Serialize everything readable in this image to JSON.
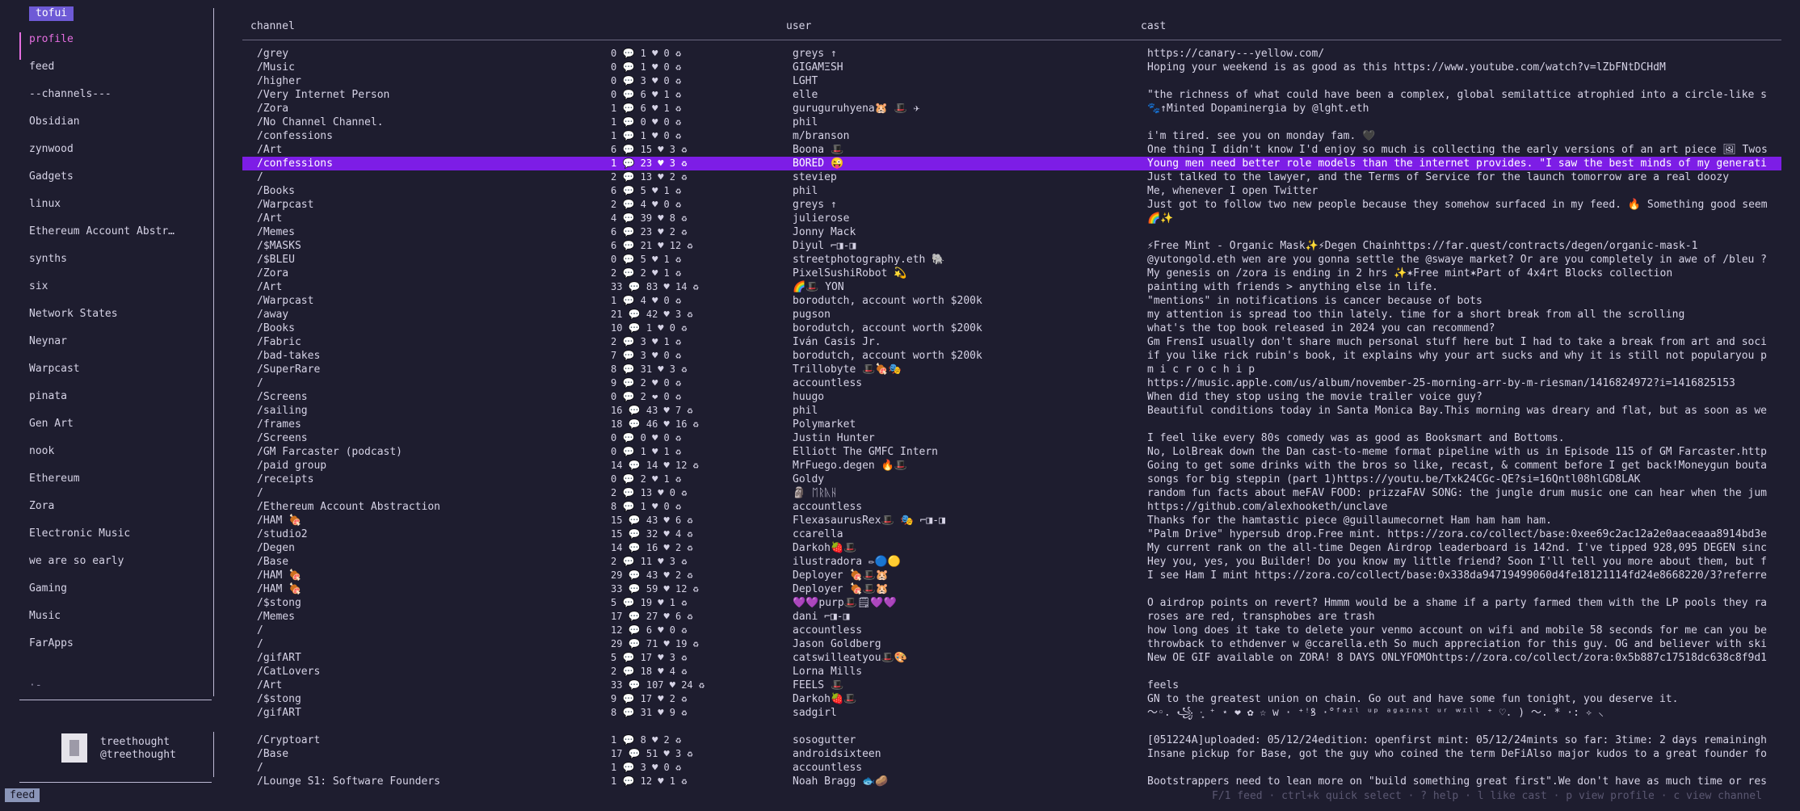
{
  "app": {
    "tag": "tofui",
    "mode": "feed"
  },
  "sidebar": {
    "items": [
      {
        "label": "profile",
        "active": true
      },
      {
        "label": "feed"
      },
      {
        "label": "--channels---"
      },
      {
        "label": "Obsidian"
      },
      {
        "label": "zynwood"
      },
      {
        "label": "Gadgets"
      },
      {
        "label": "linux"
      },
      {
        "label": "Ethereum Account Abstr…"
      },
      {
        "label": "synths"
      },
      {
        "label": "six"
      },
      {
        "label": "Network States"
      },
      {
        "label": "Neynar"
      },
      {
        "label": "Warpcast"
      },
      {
        "label": "pinata"
      },
      {
        "label": "Gen Art"
      },
      {
        "label": "nook"
      },
      {
        "label": "Ethereum"
      },
      {
        "label": "Zora"
      },
      {
        "label": "Electronic Music"
      },
      {
        "label": "we are so early"
      },
      {
        "label": "Gaming"
      },
      {
        "label": "Music"
      },
      {
        "label": "FarApps"
      }
    ],
    "more": "·-"
  },
  "user": {
    "name": "treethought",
    "handle": "@treethought"
  },
  "columns": {
    "channel": "channel",
    "user": "user",
    "cast": "cast"
  },
  "rows": [
    {
      "channel": "/grey",
      "stats": "0 💬  1 ♥  0 ♻",
      "user": "greys ↑",
      "cast": "https://canary---yellow.com/"
    },
    {
      "channel": "/Music",
      "stats": "0 💬  1 ♥  0 ♻",
      "user": "GIGAMΞSH",
      "cast": "Hoping your weekend is as good as this https://www.youtube.com/watch?v=lZbFNtDCHdM"
    },
    {
      "channel": "/higher",
      "stats": "0 💬  3 ♥  0 ♻",
      "user": "LGHT",
      "cast": ""
    },
    {
      "channel": "/Very Internet Person",
      "stats": "0 💬  6 ♥  1 ♻",
      "user": "elle",
      "cast": "\"the richness of what could have been a complex, global semilattice atrophied into a circle-like s"
    },
    {
      "channel": "/Zora",
      "stats": "1 💬  6 ♥  1 ♻",
      "user": "guruguruhyena🐹 🎩 ✈",
      "cast": "🐾↑Minted Dopaminergia by @lght.eth"
    },
    {
      "channel": "/No Channel Channel.",
      "stats": "1 💬  0 ♥  0 ♻",
      "user": "phil",
      "cast": ""
    },
    {
      "channel": "/confessions",
      "stats": "1 💬  1 ♥  0 ♻",
      "user": "m/branson",
      "cast": "i'm tired. see you on monday fam. 🖤"
    },
    {
      "channel": "/Art",
      "stats": "6 💬 15 ♥  3 ♻",
      "user": "Boona 🎩",
      "cast": "One thing I didn't know I'd enjoy so much is collecting the early versions of an art piece 🖼 Twos"
    },
    {
      "channel": "/confessions",
      "stats": "1 💬 23 ♥  3 ♻",
      "user": "BORED 😜",
      "cast": "Young men need better role models than the internet provides. \"I saw the best minds of my generati",
      "selected": true
    },
    {
      "channel": "/",
      "stats": "2 💬 13 ♥  2 ♻",
      "user": "steviep",
      "cast": "Just talked to the lawyer, and the Terms of Service for the launch tomorrow are a real doozy"
    },
    {
      "channel": "/Books",
      "stats": "6 💬  5 ♥  1 ♻",
      "user": "phil",
      "cast": "Me, whenever I open Twitter"
    },
    {
      "channel": "/Warpcast",
      "stats": "2 💬  4 ♥  0 ♻",
      "user": "greys ↑",
      "cast": "Just got to follow two new people because they somehow surfaced in my feed. 🔥 Something good seem"
    },
    {
      "channel": "/Art",
      "stats": "4 💬 39 ♥  8 ♻",
      "user": "julierose",
      "cast": "🌈✨"
    },
    {
      "channel": "/Memes",
      "stats": "6 💬 23 ♥  2 ♻",
      "user": "Jonny Mack",
      "cast": ""
    },
    {
      "channel": "/$MASKS",
      "stats": "6 💬 21 ♥ 12 ♻",
      "user": "Diyul ⌐◨-◨",
      "cast": "⚡Free Mint - Organic Mask✨⚡Degen Chainhttps://far.quest/contracts/degen/organic-mask-1"
    },
    {
      "channel": "/$BLEU",
      "stats": "0 💬  5 ♥  1 ♻",
      "user": "streetphotography.eth 🐘",
      "cast": "@yutongold.eth wen are you gonna settle the @swaye market? Or are you completely in awe of /bleu ?"
    },
    {
      "channel": "/Zora",
      "stats": "2 💬  2 ♥  1 ♻",
      "user": "PixelSushiRobot 💫",
      "cast": "My genesis on /zora is ending in 2 hrs ✨✶Free mint✶Part of 4x4rt Blocks collection"
    },
    {
      "channel": "/Art",
      "stats": "33 💬 83 ♥ 14 ♻",
      "user": "🌈🎩 YON",
      "cast": "painting with friends > anything else in life."
    },
    {
      "channel": "/Warpcast",
      "stats": "1 💬  4 ♥  0 ♻",
      "user": "borodutch, account worth $200k",
      "cast": "\"mentions\" in notifications is cancer because of bots"
    },
    {
      "channel": "/away",
      "stats": "21 💬 42 ♥  3 ♻",
      "user": "pugson",
      "cast": "my attention is spread too thin lately. time for a short break from all the scrolling"
    },
    {
      "channel": "/Books",
      "stats": "10 💬  1 ♥  0 ♻",
      "user": "borodutch, account worth $200k",
      "cast": "what's the top book released in 2024 you can recommend?"
    },
    {
      "channel": "/Fabric",
      "stats": "2 💬  3 ♥  1 ♻",
      "user": "Iván Casis Jr.",
      "cast": "Gm FrensI usually don't share much personal stuff here but I had to take a break from art and soci"
    },
    {
      "channel": "/bad-takes",
      "stats": "7 💬  3 ♥  0 ♻",
      "user": "borodutch, account worth $200k",
      "cast": "if you like rick rubin's book, it explains why your art sucks and why it is still not popularyou p"
    },
    {
      "channel": "/SuperRare",
      "stats": "8 💬 31 ♥  3 ♻",
      "user": "Trillobyte 🎩🍖🎭",
      "cast": "m i c r o c h i p"
    },
    {
      "channel": "/",
      "stats": "9 💬  2 ♥  0 ♻",
      "user": "accountless",
      "cast": "https://music.apple.com/us/album/november-25-morning-arr-by-m-riesman/1416824972?i=1416825153"
    },
    {
      "channel": "/Screens",
      "stats": "0 💬  2 ❤  0 ♻",
      "user": "huugo",
      "cast": "When did they stop using the movie trailer voice guy?"
    },
    {
      "channel": "/sailing",
      "stats": "16 💬 43 ♥  7 ♻",
      "user": "phil",
      "cast": "Beautiful conditions today in Santa Monica Bay.This morning was dreary and flat, but as soon as we"
    },
    {
      "channel": "/frames",
      "stats": "18 💬 46 ♥ 16 ♻",
      "user": "Polymarket",
      "cast": ""
    },
    {
      "channel": "/Screens",
      "stats": "0 💬  0 ♥  0 ♻",
      "user": "Justin Hunter",
      "cast": "I feel like every 80s comedy was as good as Booksmart and Bottoms."
    },
    {
      "channel": "/GM Farcaster (podcast)",
      "stats": "0 💬  1 ♥  1 ♻",
      "user": "Elliott The GMFC Intern",
      "cast": "No, LolBreak down the Dan cast-to-meme format pipeline with us in Episode 115 of GM Farcaster.http"
    },
    {
      "channel": "/paid group",
      "stats": "14 💬 14 ♥ 12 ♻",
      "user": "MrFuego.degen 🔥🎩",
      "cast": "Going to get some drinks with the bros so like, recast, & comment before I get back!Moneygun bouta"
    },
    {
      "channel": "/receipts",
      "stats": "0 💬  2 ♥  1 ♻",
      "user": "Goldy",
      "cast": "songs for big steppin (part 1)https://youtu.be/Txk24CGc-QE?si=16Qntl08hlGD8LAK"
    },
    {
      "channel": "/",
      "stats": "2 💬 13 ♥  0 ♻",
      "user": "🗿 ᛖᚱᚣᚺ",
      "cast": "random fun facts about meFAV FOOD: prizzaFAV SONG: the jungle drum music one can hear when the jum"
    },
    {
      "channel": "/Ethereum Account Abstraction",
      "stats": "8 💬  1 ♥  0 ♻",
      "user": "accountless",
      "cast": "https://github.com/alexhooketh/unclave"
    },
    {
      "channel": "/HAM 🍖",
      "stats": "15 💬 43 ♥  6 ♻",
      "user": "FlexasaurusRex🎩 🎭 ⌐◨-◨",
      "cast": "Thanks for the hamtastic piece @guillaumecornet Ham ham ham ham."
    },
    {
      "channel": "/studio2",
      "stats": "15 💬 32 ♥  4 ♻",
      "user": "ccarella",
      "cast": "\"Palm Drive\" hypersub drop.Free mint. https://zora.co/collect/base:0xee69c2ac12a2e0aaceaaa8914bd3e"
    },
    {
      "channel": "/Degen",
      "stats": "14 💬 16 ♥  2 ♻",
      "user": "Darkoh🍓🎩",
      "cast": "My current rank on the all-time Degen Airdrop leaderboard is 142nd. I've tipped 928,095 DEGEN sinc"
    },
    {
      "channel": "/Base",
      "stats": "2 💬 11 ♥  3 ♻",
      "user": "ilustradora ✏🔵🟡",
      "cast": "Hey you, yes, you Builder! Do you know my little friend? Soon I'll tell you more about them, but f"
    },
    {
      "channel": "/HAM 🍖",
      "stats": "29 💬 43 ♥  2 ♻",
      "user": "Deployer 🍖🎩🐹",
      "cast": "I see Ham I mint https://zora.co/collect/base:0x338da94719499060d4fe18121114fd24e8668220/3?referre"
    },
    {
      "channel": "/HAM 🍖",
      "stats": "33 💬 59 ♥ 12 ♻",
      "user": "Deployer 🍖🎩🐹",
      "cast": ""
    },
    {
      "channel": "/$stong",
      "stats": "5 💬 19 ♥  1 ♻",
      "user": "💜💜purp🎩🗒💜💜",
      "cast": "O airdrop points on revert? Hmmm would be a shame if a party farmed them with the LP pools they ra"
    },
    {
      "channel": "/Memes",
      "stats": "17 💬 27 ♥  6 ♻",
      "user": "dani ⌐◨-◨",
      "cast": "roses are red, transphobes are trash"
    },
    {
      "channel": "/",
      "stats": "12 💬  6 ♥  0 ♻",
      "user": "accountless",
      "cast": "how long does it take to delete your venmo account on wifi and mobile 58 seconds for me can you be"
    },
    {
      "channel": "/",
      "stats": "29 💬 71 ♥ 19 ♻",
      "user": "Jason Goldberg",
      "cast": "throwback to ethdenver w @ccarella.eth So much appreciation for this guy. OG and believer with ski"
    },
    {
      "channel": "/gifART",
      "stats": "5 💬 17 ♥  3 ♻",
      "user": "catswilleatyou🎩🎨",
      "cast": "New OE GIF available on ZORA! 8 DAYS ONLYFOMOhttps://zora.co/collect/zora:0x5b887c17518dc638c8f9d1"
    },
    {
      "channel": "/CatLovers",
      "stats": "2 💬 18 ♥  4 ♻",
      "user": "Lorna Mills",
      "cast": ""
    },
    {
      "channel": "/Art",
      "stats": "33 💬 107 ♥ 24 ♻",
      "user": "FEELS 🎩",
      "cast": "feels"
    },
    {
      "channel": "/$stong",
      "stats": "9 💬 17 ♥  2 ♻",
      "user": "Darkoh🍓🎩",
      "cast": "GN to the greatest union on chain. Go out and have some fun tonight, you deserve it."
    },
    {
      "channel": "/gifART",
      "stats": "8 💬 31 ♥  9 ♻",
      "user": "sadgirl",
      "cast": "～◦. ꧁ ·̩͙ ⁺ ⋆ ❤ ✿ ☆ w · ⁺ꜝꝸ ·°ᶠᵃᶦˡ ᵘᵖ ᵃᵍᵃᶦⁿˢᵗ ᵘʳ ʷᶦˡˡ ⁺ ♡. ) ～. * ·: ✧ ⸜"
    },
    {
      "channel": "",
      "stats": "",
      "user": "",
      "cast": "",
      "gap": true
    },
    {
      "channel": "/Cryptoart",
      "stats": "1 💬  8 ♥  2 ♻",
      "user": "sosogutter",
      "cast": "[051224A]uploaded: 05/12/24edition: openfirst mint: 05/12/24mints so far: 3time: 2 days remainingh"
    },
    {
      "channel": "/Base",
      "stats": "17 💬 51 ♥  3 ♻",
      "user": "androidsixteen",
      "cast": "Insane pickup for Base, got the guy who coined the term DeFiAlso major kudos to a great founder fo"
    },
    {
      "channel": "/",
      "stats": "1 💬  3 ♥  0 ♻",
      "user": "accountless",
      "cast": ""
    },
    {
      "channel": "/Lounge S1: Software Founders",
      "stats": "1 💬 12 ♥  1 ♻",
      "user": "Noah Bragg 🐟🥔",
      "cast": "Bootstrappers need to lean more on \"build something great first\".We don't have as much time or res"
    }
  ],
  "status_bar": "F/1 feed · ctrl+k quick select · ? help · l like cast · p view profile · c view channel"
}
